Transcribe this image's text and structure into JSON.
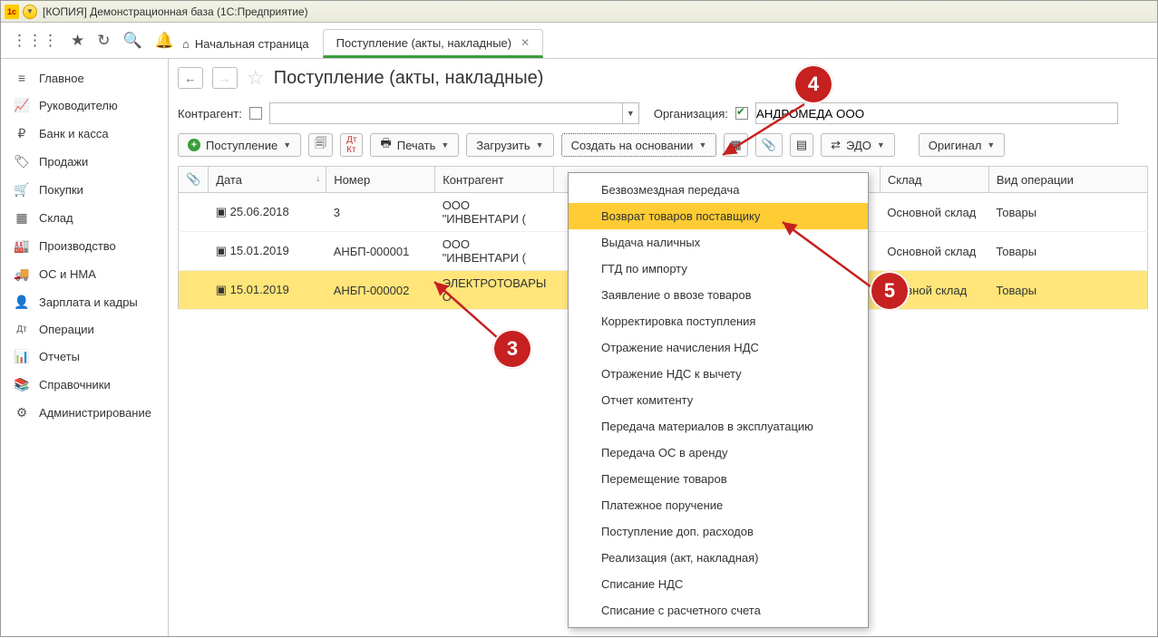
{
  "window_title": "[КОПИЯ] Демонстрационная база  (1С:Предприятие)",
  "tabs": {
    "home": "Начальная страница",
    "active": "Поступление (акты, накладные)"
  },
  "sidebar": {
    "items": [
      {
        "icon": "≡",
        "label": "Главное"
      },
      {
        "icon": "📈",
        "label": "Руководителю"
      },
      {
        "icon": "₽",
        "label": "Банк и касса"
      },
      {
        "icon": "🏷",
        "label": "Продажи"
      },
      {
        "icon": "🛒",
        "label": "Покупки"
      },
      {
        "icon": "▦",
        "label": "Склад"
      },
      {
        "icon": "🏭",
        "label": "Производство"
      },
      {
        "icon": "🚚",
        "label": "ОС и НМА"
      },
      {
        "icon": "👤",
        "label": "Зарплата и кадры"
      },
      {
        "icon": "Дт",
        "label": "Операции"
      },
      {
        "icon": "📊",
        "label": "Отчеты"
      },
      {
        "icon": "📚",
        "label": "Справочники"
      },
      {
        "icon": "⚙",
        "label": "Администрирование"
      }
    ]
  },
  "page_title": "Поступление (акты, накладные)",
  "filter": {
    "counterparty_label": "Контрагент:",
    "org_label": "Организация:",
    "org_value": "АНДРОМЕДА ООО"
  },
  "toolbar": {
    "receipt": "Поступление",
    "print": "Печать",
    "load": "Загрузить",
    "create_based": "Создать на основании",
    "edo": "ЭДО",
    "original": "Оригинал"
  },
  "columns": {
    "attach": "",
    "date": "Дата",
    "number": "Номер",
    "counterparty": "Контрагент",
    "warehouse": "Склад",
    "optype": "Вид операции"
  },
  "rows": [
    {
      "date": "25.06.2018",
      "number": "3",
      "counterparty": "ООО \"ИНВЕНТАРИ (",
      "warehouse": "Основной склад",
      "optype": "Товары"
    },
    {
      "date": "15.01.2019",
      "number": "АНБП-000001",
      "counterparty": "ООО \"ИНВЕНТАРИ (",
      "warehouse": "Основной склад",
      "optype": "Товары"
    },
    {
      "date": "15.01.2019",
      "number": "АНБП-000002",
      "counterparty": "ЭЛЕКТРОТОВАРЫ О",
      "warehouse": "сновной склад",
      "optype": "Товары"
    }
  ],
  "menu": {
    "items": [
      "Безвозмездная передача",
      "Возврат товаров поставщику",
      "Выдача наличных",
      "ГТД по импорту",
      "Заявление о ввозе товаров",
      "Корректировка поступления",
      "Отражение начисления НДС",
      "Отражение НДС к вычету",
      "Отчет комитенту",
      "Передача материалов в эксплуатацию",
      "Передача ОС в аренду",
      "Перемещение товаров",
      "Платежное поручение",
      "Поступление доп. расходов",
      "Реализация (акт, накладная)",
      "Списание НДС",
      "Списание с расчетного счета"
    ],
    "highlighted_index": 1
  },
  "markers": {
    "3": "3",
    "4": "4",
    "5": "5"
  }
}
